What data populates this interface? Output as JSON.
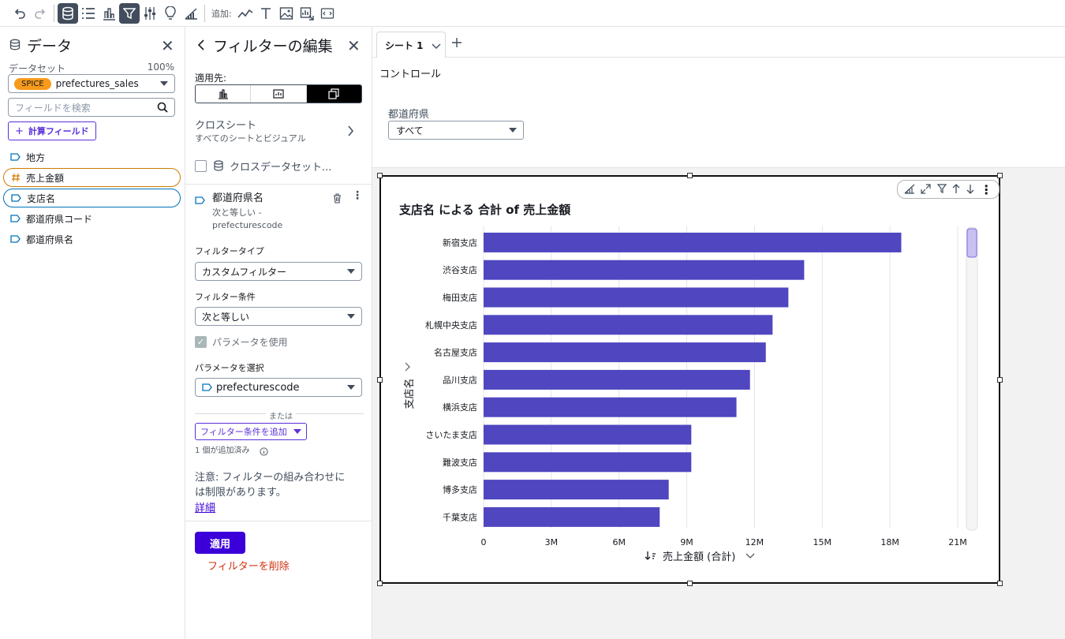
{
  "toolbar": {
    "add_label": "追加:",
    "icons": [
      "undo-icon",
      "redo-icon",
      "database-icon",
      "list-icon",
      "bar-chart-icon",
      "filter-icon",
      "sliders-icon",
      "lightbulb-icon",
      "forecast-icon",
      "line-chart-icon",
      "text-icon",
      "image-icon",
      "insight-icon",
      "embed-icon"
    ]
  },
  "data_panel": {
    "title": "データ",
    "dataset_label": "データセット",
    "dataset_pct": "100%",
    "spice": "SPICE",
    "dataset_name": "prefectures_sales",
    "search_placeholder": "フィールドを検索",
    "calc_button": "計算フィールド",
    "fields": [
      {
        "label": "地方",
        "type": "dimension",
        "state": ""
      },
      {
        "label": "売上金額",
        "type": "measure",
        "state": "orange"
      },
      {
        "label": "支店名",
        "type": "dimension",
        "state": "blue"
      },
      {
        "label": "都道府県コード",
        "type": "dimension",
        "state": ""
      },
      {
        "label": "都道府県名",
        "type": "dimension",
        "state": ""
      }
    ]
  },
  "filter_panel": {
    "title": "フィルターの編集",
    "apply_to_label": "適用先:",
    "cross_sheet_title": "クロスシート",
    "cross_sheet_sub": "すべてのシートとビジュアル",
    "cross_dataset": "クロスデータセット...",
    "filter_field": "都道府県名",
    "filter_desc1": "次と等しい -",
    "filter_desc2": "prefecturescode",
    "filter_type_label": "フィルタータイプ",
    "filter_type_value": "カスタムフィルター",
    "filter_cond_label": "フィルター条件",
    "filter_cond_value": "次と等しい",
    "use_param_label": "パラメータを使用",
    "select_param_label": "パラメータを選択",
    "param_value": "prefecturescode",
    "or_label": "または",
    "add_cond_button": "フィルター条件を追加",
    "added_count": "1 個が追加済み",
    "note_line1": "注意: フィルターの組み合わせに",
    "note_line2": "は制限があります。",
    "details_link": "詳細",
    "apply_button": "適用",
    "delete_button": "フィルターを削除"
  },
  "sheet": {
    "tab_label": "シート 1",
    "controls_title": "コントロール",
    "control_label": "都道府県",
    "control_value": "すべて"
  },
  "chart_data": {
    "type": "bar",
    "orientation": "horizontal",
    "title": "支店名 による 合計 of 売上金額",
    "ylabel": "支店名",
    "xlabel": "売上金額 (合計)",
    "categories": [
      "新宿支店",
      "渋谷支店",
      "梅田支店",
      "札幌中央支店",
      "名古屋支店",
      "品川支店",
      "横浜支店",
      "さいたま支店",
      "難波支店",
      "博多支店",
      "千葉支店"
    ],
    "values": [
      18500000,
      14200000,
      13500000,
      12800000,
      12500000,
      11800000,
      11200000,
      9200000,
      9200000,
      8200000,
      7800000
    ],
    "xlim": [
      0,
      21000000
    ],
    "ticks": [
      0,
      3000000,
      6000000,
      9000000,
      12000000,
      15000000,
      18000000,
      21000000
    ],
    "tick_labels": [
      "0",
      "3M",
      "6M",
      "9M",
      "12M",
      "15M",
      "18M",
      "21M"
    ],
    "bar_color": "#4f46c0",
    "grid": true
  }
}
